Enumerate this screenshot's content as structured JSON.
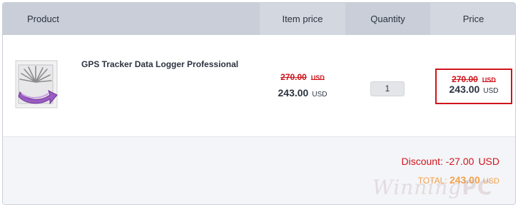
{
  "header": {
    "product": "Product",
    "item_price": "Item price",
    "quantity": "Quantity",
    "price": "Price"
  },
  "item": {
    "name": "GPS Tracker Data Logger Professional",
    "icon": "product-box-icon",
    "item_price_old": "270.00",
    "item_price_old_currency": "USD",
    "item_price_new": "243.00",
    "item_price_new_currency": "USD",
    "quantity": "1",
    "price_old": "270.00",
    "price_old_currency": "USD",
    "price_new": "243.00",
    "price_new_currency": "USD"
  },
  "summary": {
    "discount_label": "Discount: -27.00",
    "discount_currency": "USD",
    "total_label": "TOTAL:",
    "total_amount": "243.00",
    "total_currency": "USD"
  },
  "watermark": {
    "text": "Winning",
    "suffix": "PC"
  },
  "colors": {
    "header_bg": "#c9ced8",
    "discount_red": "#d0141c",
    "total_orange": "#f2a049",
    "highlight_border": "#d0141c"
  }
}
